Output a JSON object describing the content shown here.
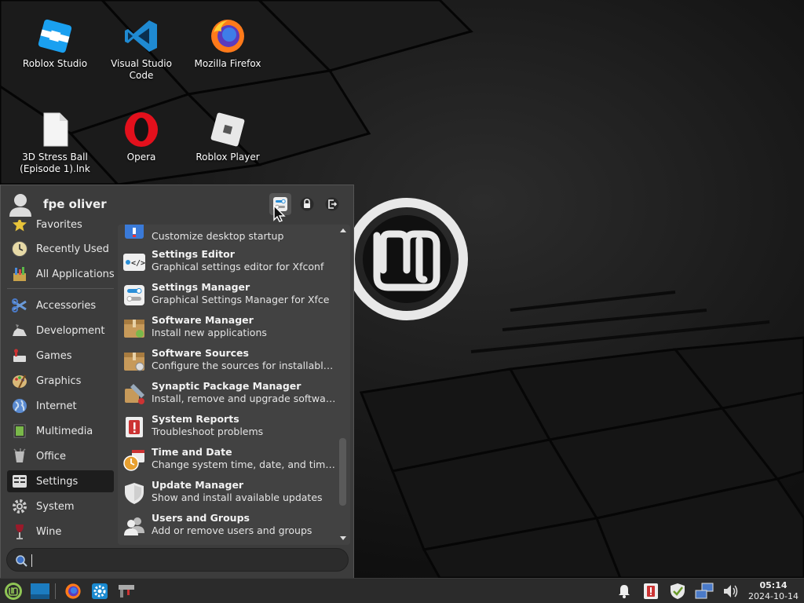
{
  "desktop": {
    "icons": [
      {
        "label": "Roblox Studio",
        "icon": "roblox-studio-icon"
      },
      {
        "label": "Visual Studio Code",
        "icon": "vscode-icon"
      },
      {
        "label": "Mozilla Firefox",
        "icon": "firefox-icon"
      },
      {
        "label": "3D Stress Ball (Episode 1).lnk",
        "icon": "file-icon"
      },
      {
        "label": "Opera",
        "icon": "opera-icon"
      },
      {
        "label": "Roblox Player",
        "icon": "roblox-player-icon"
      }
    ]
  },
  "menu": {
    "username": "fpe oliver",
    "header_buttons": [
      "settings-manager-icon",
      "lock-icon",
      "logout-icon"
    ],
    "categories": [
      {
        "label": "Favorites",
        "icon": "star-icon"
      },
      {
        "label": "Recently Used",
        "icon": "clock-icon"
      },
      {
        "label": "All Applications",
        "icon": "all-apps-icon"
      },
      {
        "label": "Accessories",
        "icon": "accessories-icon"
      },
      {
        "label": "Development",
        "icon": "development-icon"
      },
      {
        "label": "Games",
        "icon": "games-icon"
      },
      {
        "label": "Graphics",
        "icon": "graphics-icon"
      },
      {
        "label": "Internet",
        "icon": "internet-icon"
      },
      {
        "label": "Multimedia",
        "icon": "multimedia-icon"
      },
      {
        "label": "Office",
        "icon": "office-icon"
      },
      {
        "label": "Settings",
        "icon": "settings-icon"
      },
      {
        "label": "System",
        "icon": "system-icon"
      },
      {
        "label": "Wine",
        "icon": "wine-icon"
      }
    ],
    "active_category": "Settings",
    "apps": [
      {
        "name": "",
        "desc": "Customize desktop startup",
        "icon": "session-startup-icon"
      },
      {
        "name": "Settings Editor",
        "desc": "Graphical settings editor for Xfconf",
        "icon": "settings-editor-icon"
      },
      {
        "name": "Settings Manager",
        "desc": "Graphical Settings Manager for Xfce",
        "icon": "settings-manager-icon"
      },
      {
        "name": "Software Manager",
        "desc": "Install new applications",
        "icon": "software-manager-icon"
      },
      {
        "name": "Software Sources",
        "desc": "Configure the sources for installable s...",
        "icon": "software-sources-icon"
      },
      {
        "name": "Synaptic Package Manager",
        "desc": "Install, remove and upgrade software ...",
        "icon": "synaptic-icon"
      },
      {
        "name": "System Reports",
        "desc": "Troubleshoot problems",
        "icon": "system-reports-icon"
      },
      {
        "name": "Time and Date",
        "desc": "Change system time, date, and timezone",
        "icon": "time-date-icon"
      },
      {
        "name": "Update Manager",
        "desc": "Show and install available updates",
        "icon": "update-manager-icon"
      },
      {
        "name": "Users and Groups",
        "desc": "Add or remove users and groups",
        "icon": "users-groups-icon"
      }
    ],
    "search": {
      "value": "",
      "placeholder": ""
    }
  },
  "panel": {
    "launchers": [
      "mint-menu-icon",
      "show-desktop-icon",
      "firefox-icon",
      "settings-icon",
      "terminal-icon"
    ],
    "tray": [
      "notification-bell-icon",
      "update-alert-icon",
      "shield-check-icon",
      "network-icon",
      "volume-icon"
    ],
    "clock": {
      "time": "05:14",
      "date": "2024-10-14"
    }
  },
  "colors": {
    "accent": "#8fc555",
    "menu_bg": "#3c3c3c",
    "list_bg": "#424242",
    "active_category": "#1d1d1d",
    "panel_bg": "#2b2b2b"
  }
}
